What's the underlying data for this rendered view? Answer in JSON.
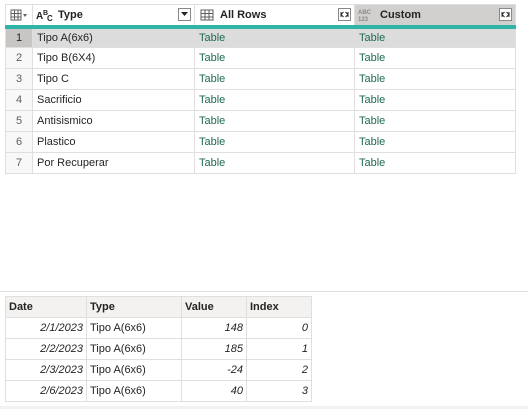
{
  "grid": {
    "columns": [
      {
        "label": "Type",
        "icon": "text-type-icon"
      },
      {
        "label": "All Rows",
        "icon": "table-type-icon"
      },
      {
        "label": "Custom",
        "icon": "any-type-icon"
      }
    ],
    "rows": [
      {
        "num": "1",
        "type": "Tipo A(6x6)",
        "all_rows": "Table",
        "custom": "Table"
      },
      {
        "num": "2",
        "type": "Tipo B(6X4)",
        "all_rows": "Table",
        "custom": "Table"
      },
      {
        "num": "3",
        "type": "Tipo C",
        "all_rows": "Table",
        "custom": "Table"
      },
      {
        "num": "4",
        "type": "Sacrificio",
        "all_rows": "Table",
        "custom": "Table"
      },
      {
        "num": "5",
        "type": "Antisismico",
        "all_rows": "Table",
        "custom": "Table"
      },
      {
        "num": "6",
        "type": "Plastico",
        "all_rows": "Table",
        "custom": "Table"
      },
      {
        "num": "7",
        "type": "Por Recuperar",
        "all_rows": "Table",
        "custom": "Table"
      }
    ],
    "selected_row": "1",
    "accent_color": "#2eb5a8"
  },
  "preview": {
    "headers": [
      "Date",
      "Type",
      "Value",
      "Index"
    ],
    "rows": [
      [
        "2/1/2023",
        "Tipo A(6x6)",
        "148",
        "0"
      ],
      [
        "2/2/2023",
        "Tipo A(6x6)",
        "185",
        "1"
      ],
      [
        "2/3/2023",
        "Tipo A(6x6)",
        "-24",
        "2"
      ],
      [
        "2/6/2023",
        "Tipo A(6x6)",
        "40",
        "3"
      ]
    ]
  }
}
